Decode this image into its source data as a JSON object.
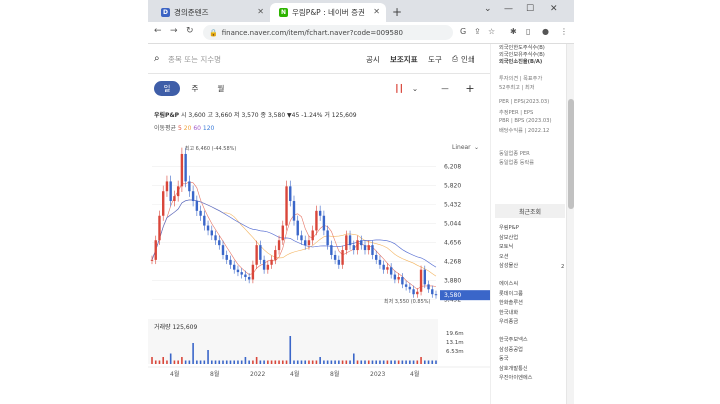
{
  "browser": {
    "tabs": [
      {
        "title": "경의준텐즈",
        "favicon_color": "#3b63c4",
        "favicon": "D"
      },
      {
        "title": "우림P&P : 네이버 증권",
        "favicon_color": "#2db400",
        "favicon": "N"
      }
    ],
    "new_tab": "+",
    "url": "finance.naver.com/item/fchart.naver?code=009580",
    "window_controls": [
      "⌄",
      "—",
      "☐",
      "✕"
    ]
  },
  "toolbar": {
    "search_placeholder": "종목 또는 지수명",
    "links": [
      "공시",
      "보조지표",
      "도구",
      "인쇄"
    ]
  },
  "period": {
    "tabs": [
      "일",
      "주",
      "월"
    ],
    "selected": "일",
    "zoom_out": "—",
    "zoom_in": "+"
  },
  "stock": {
    "name": "우림P&P",
    "summary": "시 3,600 고 3,660 저 3,570 종 3,580 ▼45 -1.24% 거 125,609",
    "ma_label": "이동평균",
    "ma_values": [
      "5",
      "20",
      "60",
      "120"
    ],
    "ma_colors": [
      "#e0523f",
      "#f0a23b",
      "#a25ac7",
      "#3b7bd8"
    ]
  },
  "chart_data": {
    "type": "line",
    "scale_label": "Linear",
    "high_label": "최고 6,460 (-44.58%)",
    "low_label": "최저 3,550 (0.85%)",
    "current_price": "3,580",
    "y_ticks": [
      "6,208",
      "5,820",
      "5,432",
      "5,044",
      "4,656",
      "4,268",
      "3,880",
      "3,492"
    ],
    "ylim": [
      3400,
      6500
    ],
    "x_ticks": [
      "4월",
      "8월",
      "2022",
      "4월",
      "8월",
      "2023",
      "4월"
    ],
    "price_color": "#d9463a",
    "down_color": "#3a66c9",
    "close": [
      4300,
      4700,
      5200,
      5700,
      5900,
      5500,
      5600,
      5800,
      6460,
      5900,
      5700,
      5500,
      5300,
      5200,
      5000,
      4900,
      4800,
      4700,
      4600,
      4400,
      4300,
      4200,
      4100,
      4050,
      4000,
      3950,
      3900,
      4200,
      4600,
      4300,
      4100,
      4200,
      4300,
      4500,
      4700,
      5000,
      5800,
      5500,
      5100,
      4800,
      4700,
      4600,
      4700,
      4900,
      5300,
      5200,
      4900,
      4600,
      4400,
      4300,
      4200,
      4500,
      4800,
      4600,
      4500,
      4700,
      4600,
      4500,
      4600,
      4400,
      4300,
      4200,
      4100,
      4150,
      4000,
      3900,
      3950,
      3800,
      3750,
      3700,
      3600,
      3650,
      4100,
      3800,
      3700,
      3600,
      3580
    ],
    "volume_label": "거래량 125,609",
    "volume_ticks": [
      "19.6m",
      "13.1m",
      "6.53m"
    ],
    "volume": [
      2,
      1,
      1,
      2,
      1,
      3,
      1,
      1,
      2,
      1,
      1,
      6,
      1,
      1,
      1,
      4,
      1,
      1,
      1,
      1,
      1,
      1,
      1,
      1,
      1,
      2,
      1,
      1,
      2,
      1,
      1,
      1,
      1,
      1,
      1,
      1,
      1,
      8,
      1,
      1,
      1,
      1,
      1,
      1,
      1,
      2,
      1,
      1,
      1,
      1,
      1,
      1,
      1,
      1,
      3,
      1,
      1,
      1,
      1,
      1,
      1,
      1,
      1,
      1,
      1,
      1,
      1,
      1,
      1,
      1,
      1,
      1,
      2,
      1,
      1,
      1,
      1
    ]
  },
  "sidebar": {
    "top_items": [
      "외국인한도주식수(B)",
      "외국인보유주식수(B)",
      "외국인소진율(B/A)",
      "투자의견 | 목표주가",
      "52주최고 | 최저",
      "PER | EPS(2023.03)",
      "추정PER | EPS",
      "PBR | BPS (2023.03)",
      "배당수익률 | 2022.12",
      "동일업종 PER",
      "동일업종 등락률"
    ],
    "recent_title": "최근조회",
    "recent_items": [
      "우림P&P",
      "삼보산업",
      "모토닉",
      "오션",
      "삼성물산",
      "에이스씨",
      "롯데이그룹",
      "한화솔루션",
      "한국내화",
      "우리종금",
      "한국주보넥스",
      "삼성중공업",
      "동국",
      "삼호개발통신",
      "우진아이엔에스"
    ],
    "badge": "2"
  }
}
